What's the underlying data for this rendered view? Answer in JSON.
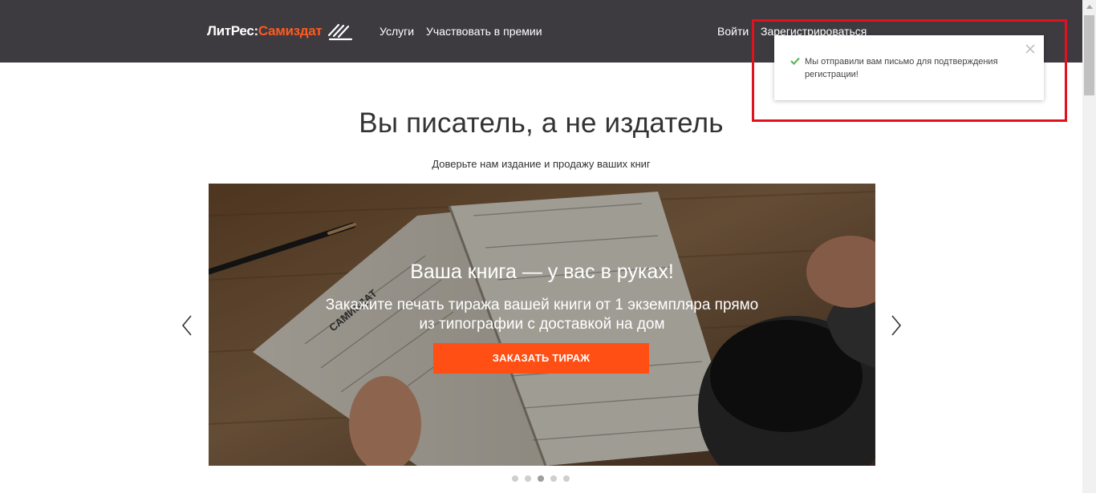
{
  "header": {
    "logo_part1": "ЛитРес:",
    "logo_part2": "Самиздат",
    "nav": [
      "Услуги",
      "Участвовать в премии"
    ],
    "login": "Войти",
    "register": "Зарегистрироваться"
  },
  "hero": {
    "title": "Вы писатель, а не издатель",
    "subtitle": "Доверьте нам издание и продажу ваших книг"
  },
  "carousel": {
    "heading": "Ваша книга — у вас в руках!",
    "text": "Закажите печать тиража вашей книги от 1 экземпляра прямо из типографии с доставкой на дом",
    "cta": "ЗАКАЗАТЬ ТИРАЖ",
    "book_spine_text": "САМИЗДАТ",
    "slides_total": 5,
    "active_slide": 3
  },
  "toast": {
    "message": "Мы отправили вам письмо для подтверждения регистрации!"
  },
  "colors": {
    "header_bg": "#3d3b40",
    "accent": "#ff5a1f",
    "cta": "#ff4f14",
    "success": "#5cb85c",
    "highlight": "#e1121e"
  },
  "icons": [
    "logo-pen-icon",
    "chevron-left-icon",
    "chevron-right-icon",
    "check-icon",
    "close-icon"
  ]
}
